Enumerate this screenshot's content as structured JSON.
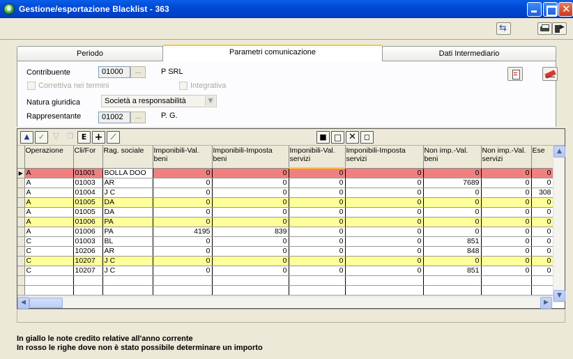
{
  "window": {
    "title": "Gestione/esportazione Blacklist - 363"
  },
  "tabs": [
    {
      "label": "Periodo"
    },
    {
      "label": "Parametri comunicazione"
    },
    {
      "label": "Dati Intermediario"
    }
  ],
  "form": {
    "contribuente_label": "Contribuente",
    "contribuente_code": "01000",
    "contribuente_name": "P  SRL",
    "correttiva_label": "Correttiva nei termini",
    "integrativa_label": "Integrativa",
    "natura_label": "Natura giuridica",
    "natura_value": "Società a responsabilità",
    "rappresentante_label": "Rappresentante",
    "rappresentante_code": "01002",
    "rappresentante_name": "P.  G.",
    "ellipsis": "..."
  },
  "grid": {
    "columns": [
      "Operazione",
      "Cli/For",
      "Rag. sociale",
      "Imponibili-Val. beni",
      "Imponibili-Imposta beni",
      "Imponibili-Val. servizi",
      "Imponibili-Imposta servizi",
      "Non imp.-Val. beni",
      "Non imp.-Val. servizi",
      "Ese"
    ],
    "rows": [
      {
        "op": "A",
        "clifor": "01001",
        "rag": "BOLLA DOO",
        "v1": "0",
        "v2": "0",
        "v3": "0",
        "v4": "0",
        "v5": "0",
        "v6": "0",
        "v7": "0",
        "style": "red"
      },
      {
        "op": "A",
        "clifor": "01003",
        "rag": "AR",
        "v1": "0",
        "v2": "0",
        "v3": "0",
        "v4": "0",
        "v5": "7689",
        "v6": "0",
        "v7": "0",
        "style": ""
      },
      {
        "op": "A",
        "clifor": "01004",
        "rag": "J C",
        "v1": "0",
        "v2": "0",
        "v3": "0",
        "v4": "0",
        "v5": "0",
        "v6": "0",
        "v7": "308",
        "style": ""
      },
      {
        "op": "A",
        "clifor": "01005",
        "rag": "DA",
        "v1": "0",
        "v2": "0",
        "v3": "0",
        "v4": "0",
        "v5": "0",
        "v6": "0",
        "v7": "0",
        "style": "yellow"
      },
      {
        "op": "A",
        "clifor": "01005",
        "rag": "DA",
        "v1": "0",
        "v2": "0",
        "v3": "0",
        "v4": "0",
        "v5": "0",
        "v6": "0",
        "v7": "0",
        "style": ""
      },
      {
        "op": "A",
        "clifor": "01006",
        "rag": "PA",
        "v1": "0",
        "v2": "0",
        "v3": "0",
        "v4": "0",
        "v5": "0",
        "v6": "0",
        "v7": "0",
        "style": "yellow"
      },
      {
        "op": "A",
        "clifor": "01006",
        "rag": "PA",
        "v1": "4195",
        "v2": "839",
        "v3": "0",
        "v4": "0",
        "v5": "0",
        "v6": "0",
        "v7": "0",
        "style": ""
      },
      {
        "op": "C",
        "clifor": "01003",
        "rag": "BL",
        "v1": "0",
        "v2": "0",
        "v3": "0",
        "v4": "0",
        "v5": "851",
        "v6": "0",
        "v7": "0",
        "style": ""
      },
      {
        "op": "C",
        "clifor": "10206",
        "rag": "AR",
        "v1": "0",
        "v2": "0",
        "v3": "0",
        "v4": "0",
        "v5": "848",
        "v6": "0",
        "v7": "0",
        "style": ""
      },
      {
        "op": "C",
        "clifor": "10207",
        "rag": "J C",
        "v1": "0",
        "v2": "0",
        "v3": "0",
        "v4": "0",
        "v5": "0",
        "v6": "0",
        "v7": "0",
        "style": "yellow"
      },
      {
        "op": "C",
        "clifor": "10207",
        "rag": "J C",
        "v1": "0",
        "v2": "0",
        "v3": "0",
        "v4": "0",
        "v5": "851",
        "v6": "0",
        "v7": "0",
        "style": ""
      }
    ]
  },
  "footer": {
    "note_yellow": "In giallo le note credito relative all'anno corrente",
    "note_red": "In rosso le righe dove non è stato possibile determinare un importo"
  },
  "colors": {
    "titlebar": "#0049D6",
    "row_red": "#F08080",
    "row_yellow": "#FFFF99",
    "tab_accent": "#FFC83C"
  }
}
